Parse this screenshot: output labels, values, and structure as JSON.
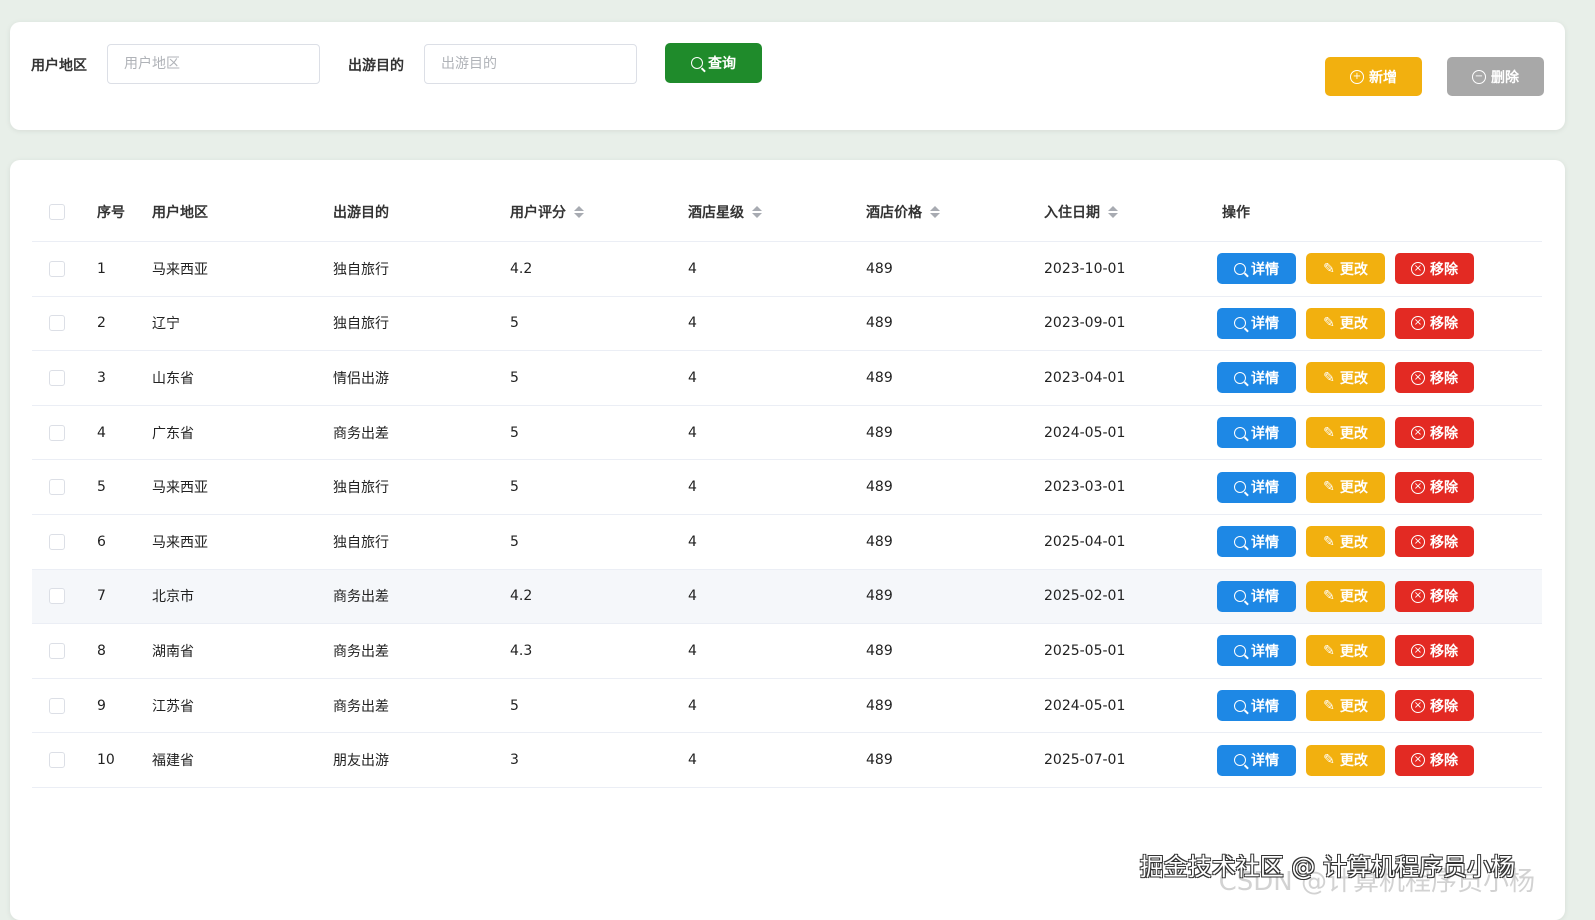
{
  "search": {
    "region_label": "用户地区",
    "region_placeholder": "用户地区",
    "purpose_label": "出游目的",
    "purpose_placeholder": "出游目的",
    "query_label": "查询",
    "add_label": "新增",
    "delete_label": "删除"
  },
  "colors": {
    "query": "#1f8b2b",
    "add": "#f2b00f",
    "delete": "#a8a8a8",
    "detail": "#1e88e5",
    "edit": "#f2b00f",
    "remove": "#e32a23"
  },
  "table": {
    "headers": [
      "序号",
      "用户地区",
      "出游目的",
      "用户评分",
      "酒店星级",
      "酒店价格",
      "入住日期",
      "操作"
    ],
    "actions": {
      "detail": "详情",
      "edit": "更改",
      "remove": "移除"
    },
    "rows": [
      [
        "1",
        "马来西亚",
        "独自旅行",
        "4.2",
        "4",
        "489",
        "2023-10-01"
      ],
      [
        "2",
        "辽宁",
        "独自旅行",
        "5",
        "4",
        "489",
        "2023-09-01"
      ],
      [
        "3",
        "山东省",
        "情侣出游",
        "5",
        "4",
        "489",
        "2023-04-01"
      ],
      [
        "4",
        "广东省",
        "商务出差",
        "5",
        "4",
        "489",
        "2024-05-01"
      ],
      [
        "5",
        "马来西亚",
        "独自旅行",
        "5",
        "4",
        "489",
        "2023-03-01"
      ],
      [
        "6",
        "马来西亚",
        "独自旅行",
        "5",
        "4",
        "489",
        "2025-04-01"
      ],
      [
        "7",
        "北京市",
        "商务出差",
        "4.2",
        "4",
        "489",
        "2025-02-01"
      ],
      [
        "8",
        "湖南省",
        "商务出差",
        "4.3",
        "4",
        "489",
        "2025-05-01"
      ],
      [
        "9",
        "江苏省",
        "商务出差",
        "5",
        "4",
        "489",
        "2024-05-01"
      ],
      [
        "10",
        "福建省",
        "朋友出游",
        "3",
        "4",
        "489",
        "2025-07-01"
      ]
    ]
  },
  "watermark": {
    "primary": "掘金技术社区 @ 计算机程序员小杨",
    "secondary": "CSDN @计算机程序员小杨"
  }
}
